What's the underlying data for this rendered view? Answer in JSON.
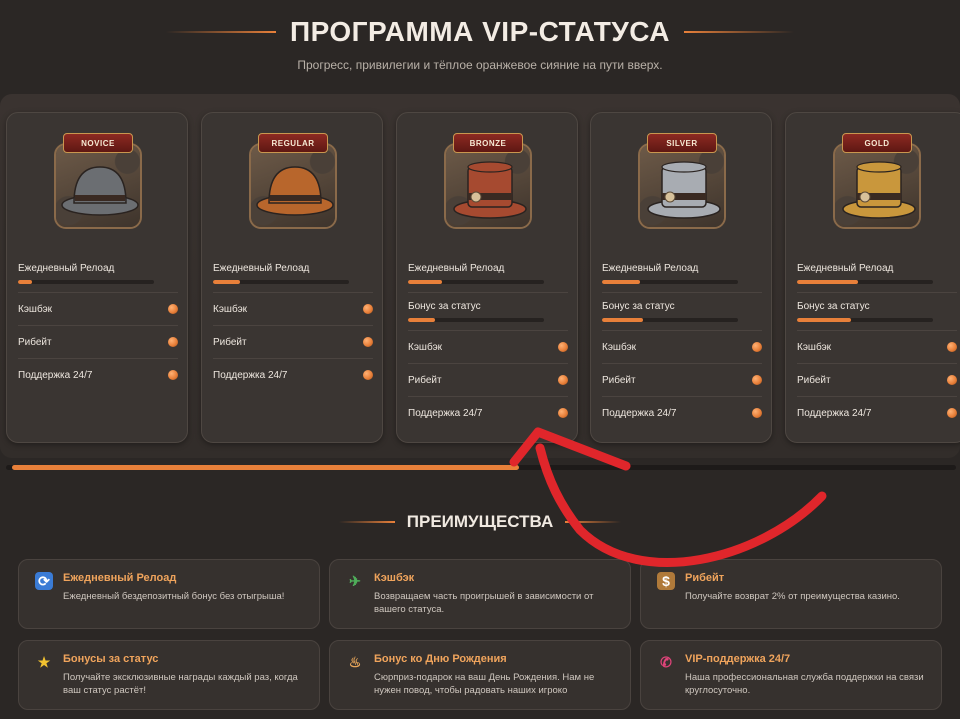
{
  "header": {
    "title": "ПРОГРАММА VIP-СТАТУСА",
    "subtitle": "Прогресс, привилегии и тёплое оранжевое сияние на пути вверх."
  },
  "tiers": [
    {
      "badge": "NOVICE",
      "hat_color": "#6b6e72",
      "reload_label": "Ежедневный Релоад",
      "reload_progress": 0.1,
      "status_bonus_label": "",
      "status_bonus_progress": 0,
      "items": [
        "Кэшбэк",
        "Рибейт",
        "Поддержка 24/7"
      ]
    },
    {
      "badge": "REGULAR",
      "hat_color": "#b8662c",
      "reload_label": "Ежедневный Релоад",
      "reload_progress": 0.2,
      "status_bonus_label": "",
      "status_bonus_progress": 0,
      "items": [
        "Кэшбэк",
        "Рибейт",
        "Поддержка 24/7"
      ]
    },
    {
      "badge": "BRONZE",
      "hat_color": "#a64a30",
      "reload_label": "Ежедневный Релоад",
      "reload_progress": 0.25,
      "status_bonus_label": "Бонус за статус",
      "status_bonus_progress": 0.2,
      "items": [
        "Кэшбэк",
        "Рибейт",
        "Поддержка 24/7"
      ]
    },
    {
      "badge": "SILVER",
      "hat_color": "#a8acb2",
      "reload_label": "Ежедневный Релоад",
      "reload_progress": 0.28,
      "status_bonus_label": "Бонус за статус",
      "status_bonus_progress": 0.3,
      "items": [
        "Кэшбэк",
        "Рибейт",
        "Поддержка 24/7"
      ]
    },
    {
      "badge": "GOLD",
      "hat_color": "#c9973c",
      "reload_label": "Ежедневный Релоад",
      "reload_progress": 0.45,
      "status_bonus_label": "Бонус за статус",
      "status_bonus_progress": 0.4,
      "items": [
        "Кэшбэк",
        "Рибейт",
        "Поддержка 24/7"
      ]
    }
  ],
  "carousel": {
    "scroll_progress": 0.54
  },
  "benefits_section": {
    "title": "ПРЕИМУЩЕСТВА",
    "items": [
      {
        "icon": "refresh-icon",
        "title": "Ежедневный Релоад",
        "text": "Ежедневный бездепозитный бонус без отыгрыша!"
      },
      {
        "icon": "money-wings-icon",
        "title": "Кэшбэк",
        "text": "Возвращаем часть проигрышей в зависимости от вашего статуса."
      },
      {
        "icon": "money-bag-icon",
        "title": "Рибейт",
        "text": "Получайте возврат 2% от преимущества казино."
      },
      {
        "icon": "star-icon",
        "title": "Бонусы за статус",
        "text": "Получайте эксклюзивные награды каждый раз, когда ваш статус растёт!"
      },
      {
        "icon": "cake-icon",
        "title": "Бонус ко Дню Рождения",
        "text": "Сюрприз-подарок на ваш День Рождения. Нам не нужен повод, чтобы радовать наших игроко"
      },
      {
        "icon": "phone-icon",
        "title": "VIP-поддержка 24/7",
        "text": "Наша профессиональная служба поддержки на связи круглосуточно."
      }
    ]
  },
  "colors": {
    "accent": "#e8803a",
    "background": "#2b2725",
    "annotation_arrow": "#e0262b"
  }
}
